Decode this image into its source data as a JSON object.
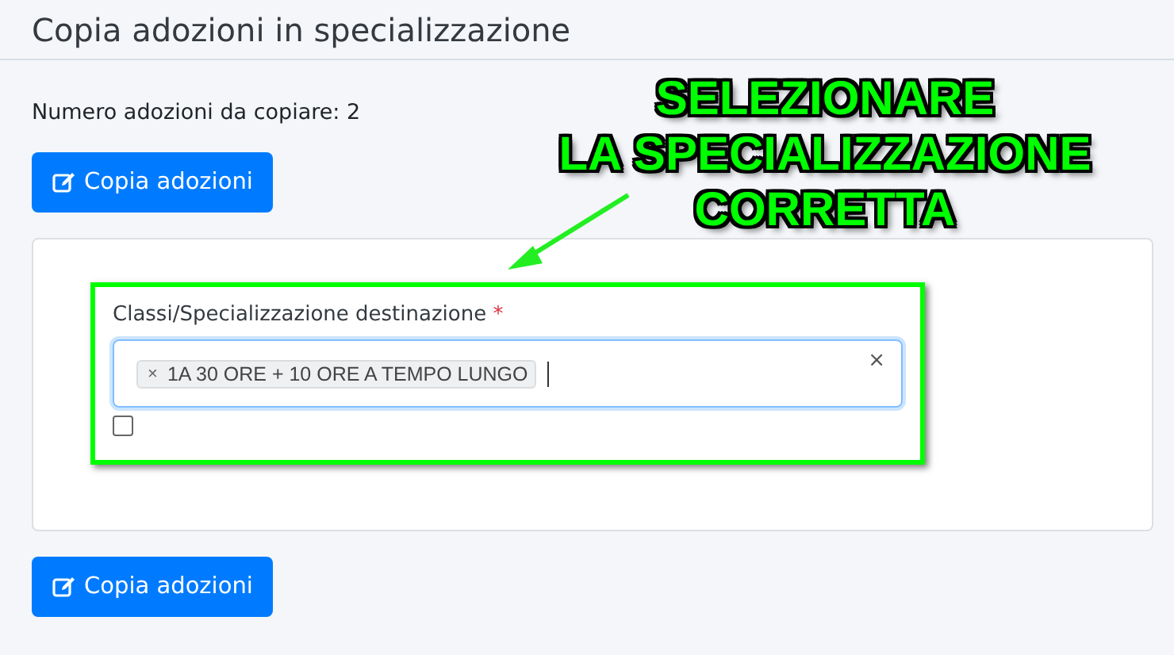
{
  "header": {
    "title": "Copia adozioni in specializzazione"
  },
  "count_text": "Numero adozioni da copiare: 2",
  "buttons": [
    {
      "label": "Copia adozioni"
    },
    {
      "label": "Copia adozioni"
    }
  ],
  "form": {
    "label": "Classi/Specializzazione destinazione",
    "required_mark": "*",
    "highlighted": true,
    "select": {
      "tags": [
        {
          "remove": "×",
          "label": "1A 30 ORE + 10 ORE A TEMPO LUNGO"
        }
      ],
      "clear": "×",
      "focused": true
    },
    "checkbox": {
      "checked": false
    }
  },
  "annotation": {
    "lines": [
      "SELEZIONARE",
      "LA SPECIALIZZAZIONE",
      "CORRETTA"
    ]
  }
}
